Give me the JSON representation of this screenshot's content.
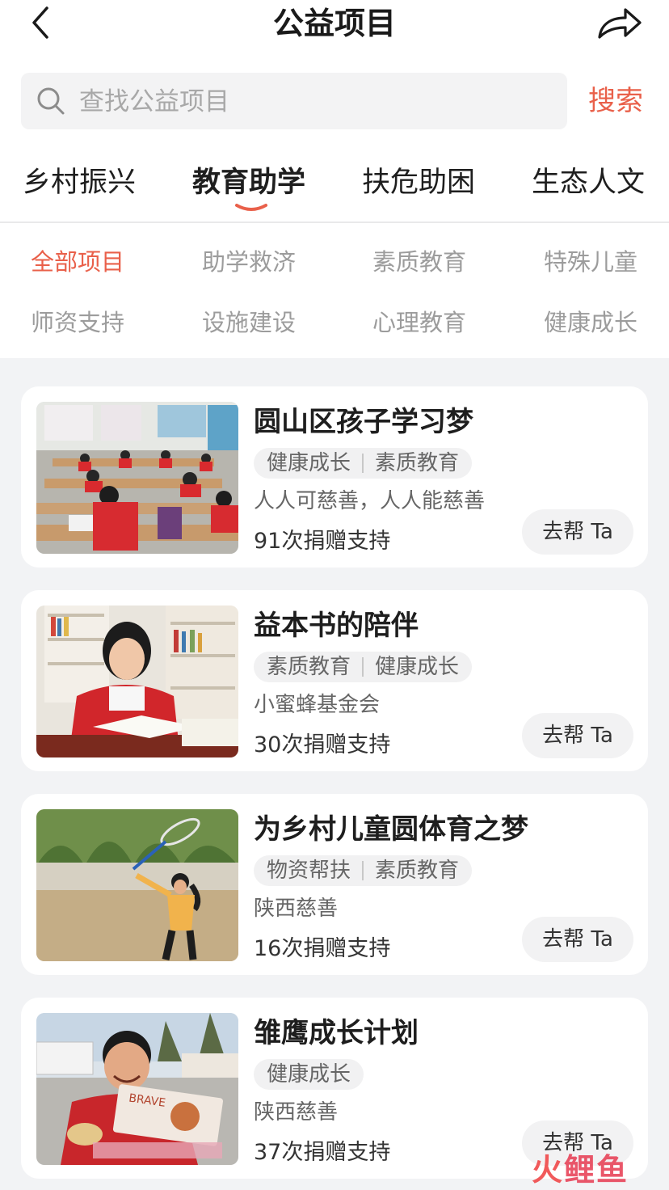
{
  "header": {
    "title": "公益项目"
  },
  "search": {
    "placeholder": "查找公益项目",
    "button_label": "搜索"
  },
  "tabs": [
    {
      "label": "乡村振兴",
      "active": false
    },
    {
      "label": "教育助学",
      "active": true
    },
    {
      "label": "扶危助困",
      "active": false
    },
    {
      "label": "生态人文",
      "active": false
    }
  ],
  "subcategories": [
    {
      "label": "全部项目",
      "active": true
    },
    {
      "label": "助学救济",
      "active": false
    },
    {
      "label": "素质教育",
      "active": false
    },
    {
      "label": "特殊儿童",
      "active": false
    },
    {
      "label": "师资支持",
      "active": false
    },
    {
      "label": "设施建设",
      "active": false
    },
    {
      "label": "心理教育",
      "active": false
    },
    {
      "label": "健康成长",
      "active": false
    }
  ],
  "projects": [
    {
      "title": "圆山区孩子学习梦",
      "tags": [
        "健康成长",
        "素质教育"
      ],
      "org": "人人可慈善，人人能慈善",
      "donations": "91次捐赠支持",
      "button": "去帮 Ta"
    },
    {
      "title": "益本书的陪伴",
      "tags": [
        "素质教育",
        "健康成长"
      ],
      "org": "小蜜蜂基金会",
      "donations": "30次捐赠支持",
      "button": "去帮 Ta"
    },
    {
      "title": "为乡村儿童圆体育之梦",
      "tags": [
        "物资帮扶",
        "素质教育"
      ],
      "org": "陕西慈善",
      "donations": "16次捐赠支持",
      "button": "去帮 Ta"
    },
    {
      "title": "雏鹰成长计划",
      "tags": [
        "健康成长"
      ],
      "org": "陕西慈善",
      "donations": "37次捐赠支持",
      "button": "去帮 Ta"
    }
  ],
  "watermark": {
    "part1": "火",
    "part2": "鲤鱼"
  },
  "colors": {
    "accent": "#e9604a",
    "background": "#f2f3f5",
    "card": "#ffffff"
  },
  "icons": {
    "back": "chevron-left-icon",
    "share": "share-arrow-icon",
    "search": "search-icon"
  }
}
